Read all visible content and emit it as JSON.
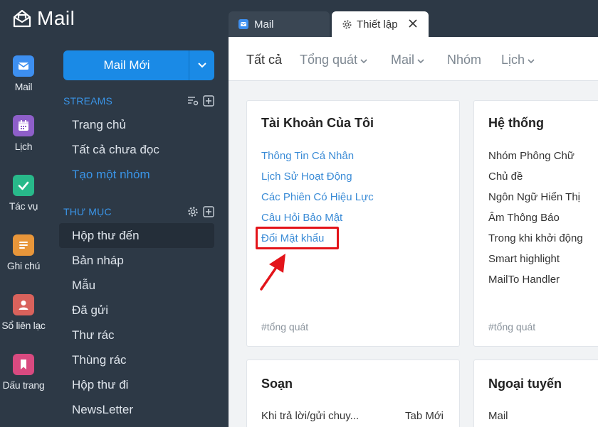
{
  "app": {
    "title": "Mail"
  },
  "rail": [
    {
      "label": "Mail",
      "icon": "mail-icon",
      "color": "#3d8ff0"
    },
    {
      "label": "Lịch",
      "icon": "calendar-icon",
      "color": "#8e5fc9"
    },
    {
      "label": "Tác vụ",
      "icon": "check-icon",
      "color": "#28b98a"
    },
    {
      "label": "Ghi chú",
      "icon": "notes-icon",
      "color": "#e8963a"
    },
    {
      "label": "Sổ liên lạc",
      "icon": "contact-icon",
      "color": "#d9625c"
    },
    {
      "label": "Dấu trang",
      "icon": "bookmark-icon",
      "color": "#d94a80"
    }
  ],
  "sidebar": {
    "compose_label": "Mail Mới",
    "streams_title": "STREAMS",
    "streams": [
      "Trang chủ",
      "Tất cả chưa đọc",
      "Tạo một nhóm"
    ],
    "folders_title": "THƯ MỤC",
    "folders": [
      "Hộp thư đến",
      "Bản nháp",
      "Mẫu",
      "Đã gửi",
      "Thư rác",
      "Thùng rác",
      "Hộp thư đi",
      "NewsLetter"
    ]
  },
  "tabs": {
    "mail": "Mail",
    "settings": "Thiết lập"
  },
  "subnav": [
    "Tất cả",
    "Tổng quát",
    "Mail",
    "Nhóm",
    "Lịch"
  ],
  "cards": {
    "account": {
      "title": "Tài Khoản Của Tôi",
      "items": [
        "Thông Tin Cá Nhân",
        "Lịch Sử Hoạt Động",
        "Các Phiên Có Hiệu Lực",
        "Câu Hỏi Bảo Mật",
        "Đổi Mật khẩu"
      ],
      "tag": "#tổng quát"
    },
    "system": {
      "title": "Hệ thống",
      "items": [
        "Nhóm Phông Chữ",
        "Chủ đề",
        "Ngôn Ngữ Hiển Thị",
        "Âm Thông Báo",
        "Trong khi khởi động",
        "Smart highlight",
        "MailTo Handler"
      ],
      "tag": "#tổng quát"
    },
    "compose": {
      "title": "Soạn",
      "item": "Khi trả lời/gửi chuy...",
      "value": "Tab Mới"
    },
    "offline": {
      "title": "Ngoại tuyến",
      "item": "Mail"
    }
  },
  "colors": {
    "sidebar_bg": "#2d3946",
    "accent": "#1a8ae6",
    "highlight": "#e3141a"
  }
}
